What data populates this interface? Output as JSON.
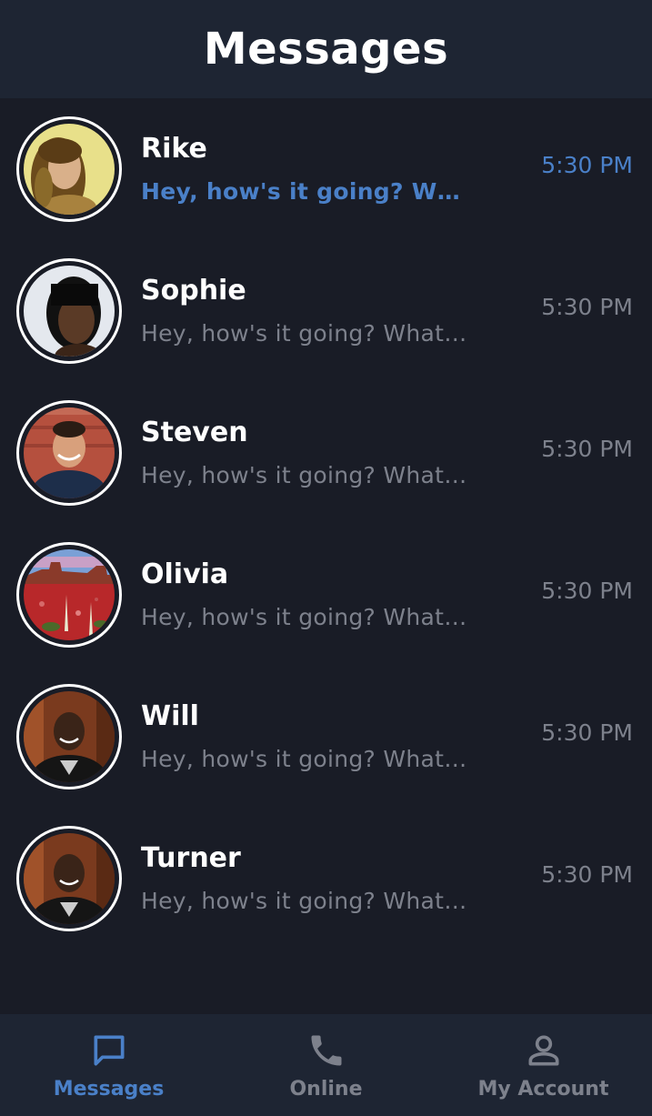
{
  "header": {
    "title": "Messages"
  },
  "conversations": [
    {
      "name": "Rike",
      "preview": "Hey, how's it going? What's up?",
      "time": "5:30 PM",
      "unread": true
    },
    {
      "name": "Sophie",
      "preview": "Hey, how's it going? What's up?",
      "time": "5:30 PM",
      "unread": false
    },
    {
      "name": "Steven",
      "preview": "Hey, how's it going? What's up?",
      "time": "5:30 PM",
      "unread": false
    },
    {
      "name": "Olivia",
      "preview": "Hey, how's it going? What's up?",
      "time": "5:30 PM",
      "unread": false
    },
    {
      "name": "Will",
      "preview": "Hey, how's it going? What's up?",
      "time": "5:30 PM",
      "unread": false
    },
    {
      "name": "Turner",
      "preview": "Hey, how's it going? What's up?",
      "time": "5:30 PM",
      "unread": false
    }
  ],
  "tabbar": {
    "tabs": [
      {
        "label": "Messages",
        "icon": "chat-bubble-icon",
        "active": true
      },
      {
        "label": "Online",
        "icon": "phone-icon",
        "active": false
      },
      {
        "label": "My Account",
        "icon": "person-icon",
        "active": false
      }
    ]
  },
  "colors": {
    "background": "#191c26",
    "header_bg": "#1e2533",
    "accent": "#4a80c8",
    "muted_text": "#7d818c",
    "primary_text": "#ffffff"
  }
}
